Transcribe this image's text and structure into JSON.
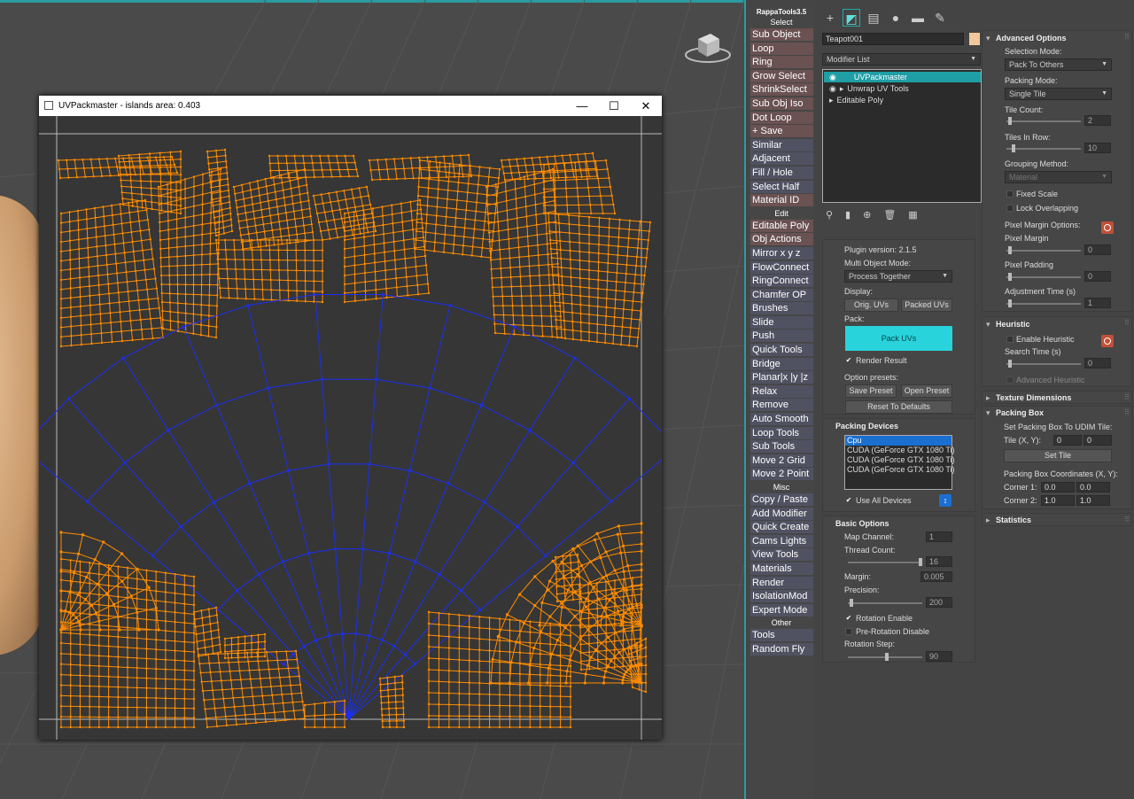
{
  "uv_window": {
    "title": "UVPackmaster - islands area: 0.403",
    "minimize": "—",
    "maximize": "☐",
    "close": "✕"
  },
  "toolbar": {
    "title": "RappaTools3.5",
    "sections": {
      "select": "Select",
      "edit": "Edit",
      "misc": "Misc",
      "other": "Other"
    },
    "select_buttons": [
      "Sub Object",
      "Loop",
      "Ring",
      "Grow Select",
      "ShrinkSelect",
      "Sub Obj Iso",
      "Dot Loop",
      "+ Save",
      "Similar",
      "Adjacent",
      "Fill / Hole",
      "Select Half",
      "Material ID"
    ],
    "edit_buttons": [
      "Editable Poly",
      "Obj Actions",
      "Mirror  x  y  z",
      "FlowConnect",
      "RingConnect",
      "Chamfer OP",
      "Brushes",
      "Slide",
      "Push",
      "Quick Tools",
      "Bridge",
      "Planar|x |y |z",
      "Relax",
      "Remove",
      "Auto Smooth",
      "Loop Tools",
      "Sub Tools",
      "Move 2 Grid",
      "Move 2 Point"
    ],
    "misc_buttons": [
      "Copy / Paste",
      "Add Modifier",
      "Quick Create",
      "Cams Lights",
      "View Tools",
      "Materials",
      "Render",
      "IsolationMod",
      "Expert Mode"
    ],
    "other_buttons": [
      "Tools",
      "Random Fly"
    ]
  },
  "modify": {
    "object_name": "Teapot001",
    "object_color": "#f2c89a",
    "modifier_list": "Modifier List",
    "stack": [
      "UVPackmaster",
      "Unwrap UV Tools",
      "Editable Poly"
    ]
  },
  "plugin": {
    "version": "Plugin version: 2.1.5",
    "multi_mode_label": "Multi Object Mode:",
    "multi_mode_value": "Process Together",
    "display_label": "Display:",
    "orig_uvs": "Orig. UVs",
    "packed_uvs": "Packed UVs",
    "pack_label": "Pack:",
    "pack_button": "Pack UVs",
    "render_result": "Render Result",
    "presets_label": "Option presets:",
    "save_preset": "Save Preset",
    "open_preset": "Open Preset",
    "reset_defaults": "Reset To Defaults"
  },
  "devices": {
    "title": "Packing Devices",
    "items": [
      "Cpu",
      "CUDA (GeForce GTX 1080 Ti)",
      "CUDA (GeForce GTX 1080 Ti)",
      "CUDA (GeForce GTX 1080 Ti)"
    ],
    "use_all": "Use All Devices"
  },
  "basic": {
    "title": "Basic Options",
    "map_channel_label": "Map Channel:",
    "map_channel": "1",
    "thread_label": "Thread Count:",
    "thread": "16",
    "margin_label": "Margin:",
    "margin": "0.005",
    "precision_label": "Precision:",
    "precision": "200",
    "rotation_enable": "Rotation Enable",
    "pre_rotation": "Pre-Rotation Disable",
    "rotation_step_label": "Rotation Step:",
    "rotation_step": "90"
  },
  "advanced": {
    "title": "Advanced Options",
    "sel_mode_label": "Selection Mode:",
    "sel_mode": "Pack To Others",
    "packing_mode_label": "Packing Mode:",
    "packing_mode": "Single Tile",
    "tile_count_label": "Tile Count:",
    "tile_count": "2",
    "tiles_row_label": "Tiles In Row:",
    "tiles_row": "10",
    "grouping_label": "Grouping Method:",
    "grouping": "Material",
    "fixed_scale": "Fixed Scale",
    "lock_overlapping": "Lock Overlapping",
    "pixel_margin_options": "Pixel Margin Options:",
    "pixel_margin_label": "Pixel Margin",
    "pixel_margin": "0",
    "pixel_padding_label": "Pixel Padding",
    "pixel_padding": "0",
    "adj_time_label": "Adjustment Time (s)",
    "adj_time": "1"
  },
  "heuristic": {
    "title": "Heuristic",
    "enable": "Enable Heuristic",
    "search_label": "Search Time (s)",
    "search": "0",
    "advanced": "Advanced Heuristic"
  },
  "texture": {
    "title": "Texture Dimensions"
  },
  "packing_box": {
    "title": "Packing Box",
    "udim_label": "Set Packing Box To UDIM Tile:",
    "tile_label": "Tile (X, Y):",
    "tile_x": "0",
    "tile_y": "0",
    "set_tile": "Set Tile",
    "coords_label": "Packing Box Coordinates (X, Y):",
    "corner1_label": "Corner 1:",
    "c1x": "0.0",
    "c1y": "0.0",
    "corner2_label": "Corner 2:",
    "c2x": "1.0",
    "c2y": "1.0"
  },
  "statistics": {
    "title": "Statistics"
  },
  "colors": {
    "island": "#ff8c00",
    "selected_island": "#1a2ff0",
    "accent": "#28d3dc",
    "frame": "#e0c000"
  }
}
